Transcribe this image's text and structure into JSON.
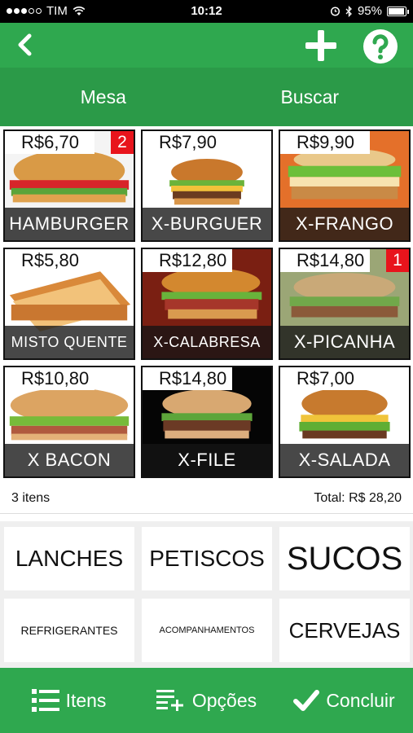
{
  "status": {
    "carrier": "TIM",
    "time": "10:12",
    "battery": "95%",
    "battery_level": 0.95
  },
  "toolbar": {
    "back_icon": "chevron-left-icon",
    "add_icon": "plus-icon",
    "help_icon": "question-icon"
  },
  "tabs": [
    {
      "label": "Mesa"
    },
    {
      "label": "Buscar"
    }
  ],
  "products": [
    {
      "price": "R$6,70",
      "name": "HAMBURGER",
      "badge": "2"
    },
    {
      "price": "R$7,90",
      "name": "X-BURGUER",
      "badge": ""
    },
    {
      "price": "R$9,90",
      "name": "X-FRANGO",
      "badge": ""
    },
    {
      "price": "R$5,80",
      "name": "MISTO QUENTE",
      "badge": ""
    },
    {
      "price": "R$12,80",
      "name": "X-CALABRESA",
      "badge": ""
    },
    {
      "price": "R$14,80",
      "name": "X-PICANHA",
      "badge": "1"
    },
    {
      "price": "R$10,80",
      "name": "X BACON",
      "badge": ""
    },
    {
      "price": "R$14,80",
      "name": "X-FILE",
      "badge": ""
    },
    {
      "price": "R$7,00",
      "name": "X-SALADA",
      "badge": ""
    }
  ],
  "summary": {
    "count": "3 itens",
    "total": "Total: R$ 28,20"
  },
  "categories": [
    {
      "label": "LANCHES"
    },
    {
      "label": "PETISCOS"
    },
    {
      "label": "SUCOS"
    },
    {
      "label": "REFRIGERANTES"
    },
    {
      "label": "ACOMPANHAMENTOS"
    },
    {
      "label": "CERVEJAS"
    }
  ],
  "bottom": {
    "items_label": "Itens",
    "options_label": "Opções",
    "finish_label": "Concluir"
  },
  "colors": {
    "primary": "#2fa84f",
    "primary_dark": "#2b9a48",
    "badge": "#e8141c"
  }
}
